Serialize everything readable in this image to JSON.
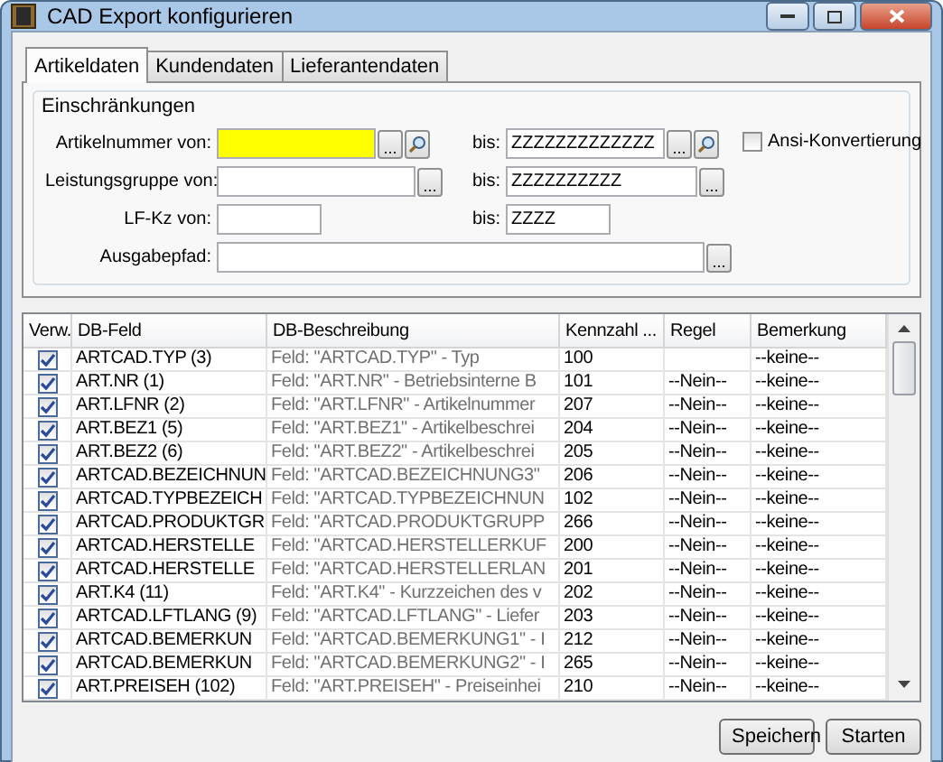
{
  "window": {
    "title": "CAD Export konfigurieren"
  },
  "tabs": [
    {
      "label": "Artikeldaten",
      "selected": true
    },
    {
      "label": "Kundendaten",
      "selected": false
    },
    {
      "label": "Lieferantendaten",
      "selected": false
    }
  ],
  "group": {
    "title": "Einschränkungen",
    "fields": [
      {
        "label": "Artikelnummer von:",
        "focused": true,
        "browse": "...",
        "search": true,
        "to": {
          "label": "bis:",
          "value": "ZZZZZZZZZZZZZ",
          "browse": "...",
          "search": true
        }
      },
      {
        "label": "Leistungsgruppe von:",
        "focused": false,
        "browse": "...",
        "search": false,
        "to": {
          "label": "bis:",
          "value": "ZZZZZZZZZZ",
          "browse": "...",
          "search": false
        }
      },
      {
        "label": "LF-Kz von:",
        "focused": false,
        "search": false,
        "to": {
          "label": "bis:",
          "value": "ZZZZ",
          "search": false
        }
      },
      {
        "label": "Ausgabepfad:",
        "focused": false,
        "browse": "...",
        "search": false
      }
    ],
    "ansi": {
      "label": "Ansi-Konvertierung",
      "checked": false
    }
  },
  "table": {
    "columns": [
      "Verw.",
      "DB-Feld",
      "DB-Beschreibung",
      "Kennzahl ...",
      "Regel",
      "Bemerkung"
    ],
    "rows": [
      {
        "checked": true,
        "field": "ARTCAD.TYP (3)",
        "description": "Feld: \"ARTCAD.TYP\" - Typ",
        "code": "100",
        "rule": "",
        "remark": "--keine--"
      },
      {
        "checked": true,
        "field": "ART.NR (1)",
        "description": "Feld: \"ART.NR\" - Betriebsinterne B",
        "code": "101",
        "rule": "--Nein--",
        "remark": "--keine--"
      },
      {
        "checked": true,
        "field": "ART.LFNR (2)",
        "description": "Feld: \"ART.LFNR\" - Artikelnummer",
        "code": "207",
        "rule": "--Nein--",
        "remark": "--keine--"
      },
      {
        "checked": true,
        "field": "ART.BEZ1 (5)",
        "description": "Feld: \"ART.BEZ1\" - Artikelbeschrei",
        "code": "204",
        "rule": "--Nein--",
        "remark": "--keine--"
      },
      {
        "checked": true,
        "field": "ART.BEZ2 (6)",
        "description": "Feld: \"ART.BEZ2\" - Artikelbeschrei",
        "code": "205",
        "rule": "--Nein--",
        "remark": "--keine--"
      },
      {
        "checked": true,
        "field": "ARTCAD.BEZEICHNUN",
        "description": "Feld: \"ARTCAD.BEZEICHNUNG3\"",
        "code": "206",
        "rule": "--Nein--",
        "remark": "--keine--"
      },
      {
        "checked": true,
        "field": "ARTCAD.TYPBEZEICH",
        "description": "Feld: \"ARTCAD.TYPBEZEICHNUN",
        "code": "102",
        "rule": "--Nein--",
        "remark": "--keine--"
      },
      {
        "checked": true,
        "field": "ARTCAD.PRODUKTGR",
        "description": "Feld: \"ARTCAD.PRODUKTGRUPP",
        "code": "266",
        "rule": "--Nein--",
        "remark": "--keine--"
      },
      {
        "checked": true,
        "field": "ARTCAD.HERSTELLE",
        "description": "Feld: \"ARTCAD.HERSTELLERKUF",
        "code": "200",
        "rule": "--Nein--",
        "remark": "--keine--"
      },
      {
        "checked": true,
        "field": "ARTCAD.HERSTELLE",
        "description": "Feld: \"ARTCAD.HERSTELLERLAN",
        "code": "201",
        "rule": "--Nein--",
        "remark": "--keine--"
      },
      {
        "checked": true,
        "field": "ART.K4 (11)",
        "description": "Feld: \"ART.K4\" - Kurzzeichen des v",
        "code": "202",
        "rule": "--Nein--",
        "remark": "--keine--"
      },
      {
        "checked": true,
        "field": "ARTCAD.LFTLANG (9)",
        "description": "Feld: \"ARTCAD.LFTLANG\" - Liefer",
        "code": "203",
        "rule": "--Nein--",
        "remark": "--keine--"
      },
      {
        "checked": true,
        "field": "ARTCAD.BEMERKUN",
        "description": "Feld: \"ARTCAD.BEMERKUNG1\" - I",
        "code": "212",
        "rule": "--Nein--",
        "remark": "--keine--"
      },
      {
        "checked": true,
        "field": "ARTCAD.BEMERKUN",
        "description": "Feld: \"ARTCAD.BEMERKUNG2\" - I",
        "code": "265",
        "rule": "--Nein--",
        "remark": "--keine--"
      },
      {
        "checked": true,
        "field": "ART.PREISEH (102)",
        "description": "Feld: \"ART.PREISEH\" - Preiseinhei",
        "code": "210",
        "rule": "--Nein--",
        "remark": "--keine--"
      }
    ]
  },
  "buttons": [
    "Speichern",
    "Starten"
  ]
}
